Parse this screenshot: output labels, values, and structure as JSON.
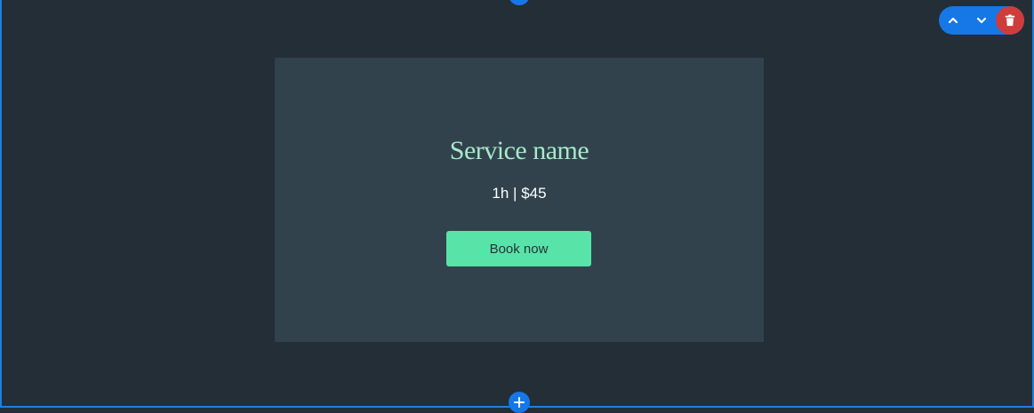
{
  "service": {
    "name": "Service name",
    "duration": "1h",
    "separator": "|",
    "price": "$45",
    "meta_text": "1h | $45",
    "book_label": "Book now"
  },
  "toolbar": {
    "move_up_icon": "chevron-up-icon",
    "move_down_icon": "chevron-down-icon",
    "delete_icon": "trash-icon"
  },
  "colors": {
    "background": "#232e37",
    "card": "#31424d",
    "accent_title": "#a7e9c9",
    "button": "#58e3a9",
    "editor_blue": "#1677e6",
    "delete_red": "#cf3c3c"
  }
}
